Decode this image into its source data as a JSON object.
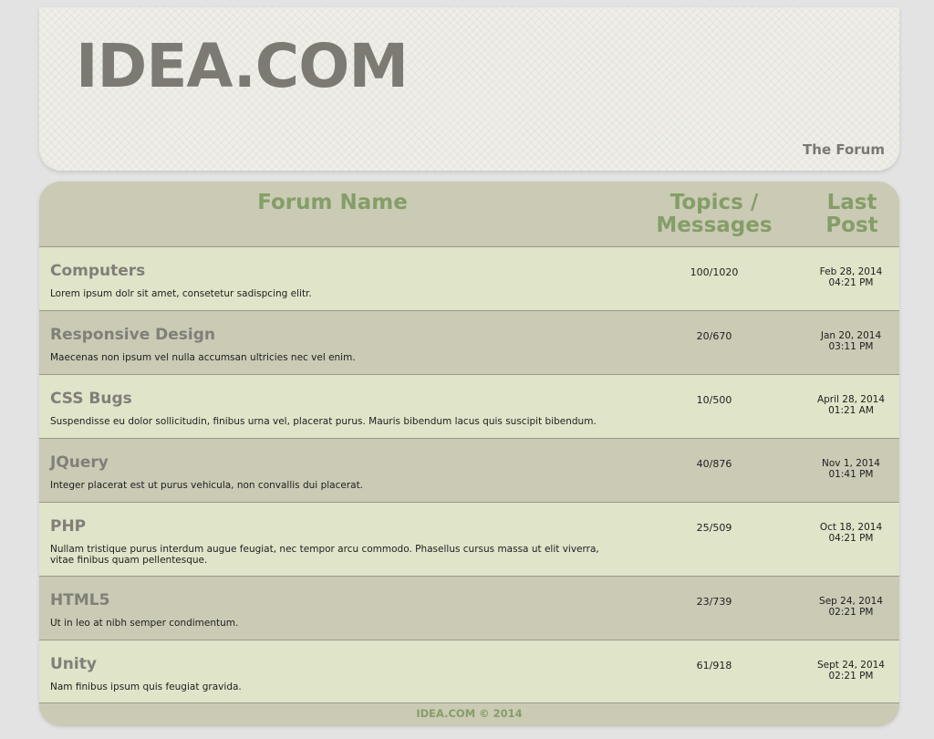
{
  "header": {
    "title": "IDEA.COM",
    "subtitle": "The Forum"
  },
  "table": {
    "col_name": "Forum Name",
    "col_topics": "Topics / Messages",
    "col_last": "Last Post"
  },
  "forums": [
    {
      "title": "Computers",
      "desc": "Lorem ipsum dolr sit amet, consetetur sadispcing elitr.",
      "count": "100/1020",
      "date": "Feb 28, 2014",
      "time": "04:21 PM"
    },
    {
      "title": "Responsive Design",
      "desc": "Maecenas non ipsum vel nulla accumsan ultricies nec vel enim.",
      "count": "20/670",
      "date": "Jan 20, 2014",
      "time": "03:11 PM"
    },
    {
      "title": "CSS Bugs",
      "desc": "Suspendisse eu dolor sollicitudin, finibus urna vel, placerat purus. Mauris bibendum lacus quis suscipit bibendum.",
      "count": "10/500",
      "date": "April 28, 2014",
      "time": "01:21 AM"
    },
    {
      "title": "JQuery",
      "desc": "Integer placerat est ut purus vehicula, non convallis dui placerat.",
      "count": "40/876",
      "date": "Nov 1, 2014",
      "time": "01:41 PM"
    },
    {
      "title": "PHP",
      "desc": "Nullam tristique purus interdum augue feugiat, nec tempor arcu commodo. Phasellus cursus massa ut elit viverra, vitae finibus quam pellentesque.",
      "count": "25/509",
      "date": "Oct 18, 2014",
      "time": "04:21 PM"
    },
    {
      "title": "HTML5",
      "desc": "Ut in leo at nibh semper condimentum.",
      "count": "23/739",
      "date": "Sep 24, 2014",
      "time": "02:21 PM"
    },
    {
      "title": "Unity",
      "desc": "Nam finibus ipsum quis feugiat gravida.",
      "count": "61/918",
      "date": "Sept 24, 2014",
      "time": "02:21 PM"
    }
  ],
  "footer": {
    "text": "IDEA.COM © 2014"
  },
  "colors": {
    "accent_green": "#849e67",
    "row_light": "#e0e4c9",
    "row_dark": "#cbcab5",
    "title_gray": "#7c7a72"
  }
}
